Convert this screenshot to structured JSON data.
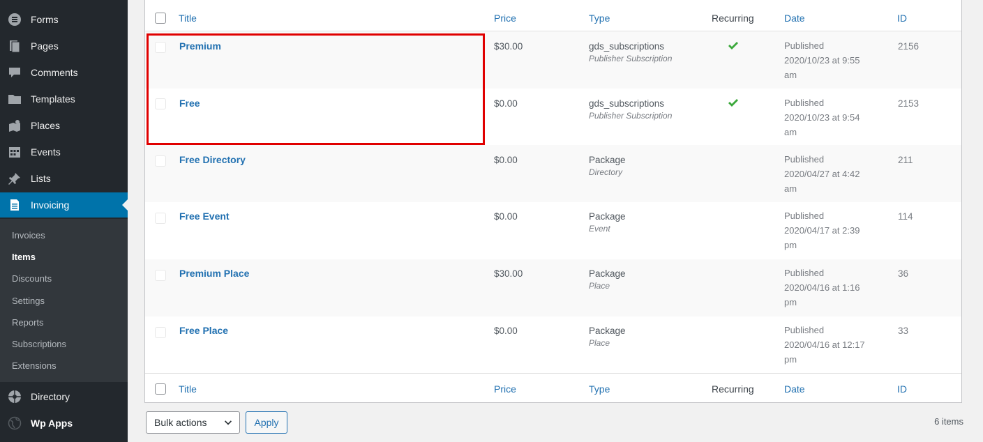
{
  "sidebar": {
    "menu": [
      {
        "label": "Forms",
        "icon": "forms-icon"
      },
      {
        "label": "Pages",
        "icon": "pages-icon"
      },
      {
        "label": "Comments",
        "icon": "comments-icon"
      },
      {
        "label": "Templates",
        "icon": "folder-icon"
      },
      {
        "label": "Places",
        "icon": "places-icon"
      },
      {
        "label": "Events",
        "icon": "calendar-icon"
      },
      {
        "label": "Lists",
        "icon": "pin-icon"
      },
      {
        "label": "Invoicing",
        "icon": "invoice-icon"
      }
    ],
    "submenu": [
      "Invoices",
      "Items",
      "Discounts",
      "Settings",
      "Reports",
      "Subscriptions",
      "Extensions"
    ],
    "current_submenu": "Items",
    "bottom_menu": [
      {
        "label": "Directory",
        "icon": "directory-icon"
      },
      {
        "label": "Wp Apps",
        "icon": "globe-icon"
      }
    ]
  },
  "table": {
    "columns": {
      "title": "Title",
      "price": "Price",
      "type": "Type",
      "recurring": "Recurring",
      "date": "Date",
      "id": "ID"
    },
    "rows": [
      {
        "title": "Premium",
        "price": "$30.00",
        "type": "gds_subscriptions",
        "subtype": "Publisher Subscription",
        "recurring": true,
        "date": [
          "Published",
          "2020/10/23 at 9:55",
          "am"
        ],
        "id": "2156"
      },
      {
        "title": "Free",
        "price": "$0.00",
        "type": "gds_subscriptions",
        "subtype": "Publisher Subscription",
        "recurring": true,
        "date": [
          "Published",
          "2020/10/23 at 9:54",
          "am"
        ],
        "id": "2153"
      },
      {
        "title": "Free Directory",
        "price": "$0.00",
        "type": "Package",
        "subtype": "Directory",
        "recurring": false,
        "date": [
          "Published",
          "2020/04/27 at 4:42",
          "am"
        ],
        "id": "211"
      },
      {
        "title": "Free Event",
        "price": "$0.00",
        "type": "Package",
        "subtype": "Event",
        "recurring": false,
        "date": [
          "Published",
          "2020/04/17 at 2:39",
          "pm"
        ],
        "id": "114"
      },
      {
        "title": "Premium Place",
        "price": "$30.00",
        "type": "Package",
        "subtype": "Place",
        "recurring": false,
        "date": [
          "Published",
          "2020/04/16 at 1:16",
          "pm"
        ],
        "id": "36"
      },
      {
        "title": "Free Place",
        "price": "$0.00",
        "type": "Package",
        "subtype": "Place",
        "recurring": false,
        "date": [
          "Published",
          "2020/04/16 at 12:17",
          "pm"
        ],
        "id": "33"
      }
    ]
  },
  "bottom": {
    "bulk_actions": "Bulk actions",
    "apply": "Apply",
    "count": "6 items"
  },
  "colors": {
    "sidebar_bg": "#23282d",
    "active_menu": "#0073aa",
    "link": "#2271b1",
    "check": "#3aa83a",
    "highlight": "#e00000"
  }
}
